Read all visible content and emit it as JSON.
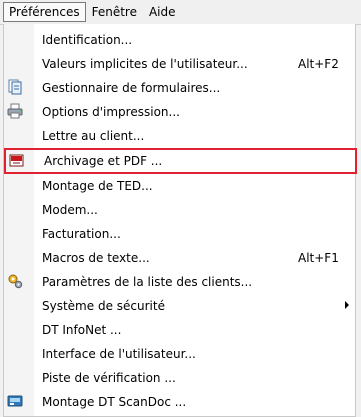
{
  "menubar": {
    "items": [
      {
        "label": "Préférences"
      },
      {
        "label": "Fenêtre"
      },
      {
        "label": "Aide"
      }
    ]
  },
  "menu": {
    "items": [
      {
        "label": "Identification..."
      },
      {
        "label": "Valeurs implicites de l'utilisateur...",
        "shortcut": "Alt+F2"
      },
      {
        "label": "Gestionnaire de formulaires...",
        "icon": "forms-manager-icon"
      },
      {
        "label": "Options d'impression...",
        "icon": "printer-icon"
      },
      {
        "label": "Lettre au client..."
      },
      {
        "label": "Archivage et PDF ...",
        "icon": "pdf-archive-icon",
        "highlighted": true
      },
      {
        "label": "Montage de TED..."
      },
      {
        "label": "Modem..."
      },
      {
        "label": "Facturation..."
      },
      {
        "label": "Macros de texte...",
        "shortcut": "Alt+F1"
      },
      {
        "label": "Paramètres de la liste des clients...",
        "icon": "settings-gears-icon"
      },
      {
        "label": "Système de sécurité",
        "submenu": true
      },
      {
        "label": "DT InfoNet ..."
      },
      {
        "label": "Interface de l'utilisateur..."
      },
      {
        "label": "Piste de vérification ..."
      },
      {
        "label": "Montage DT ScanDoc ...",
        "icon": "scanner-icon"
      }
    ]
  },
  "colors": {
    "highlight_border": "#e0212f"
  }
}
